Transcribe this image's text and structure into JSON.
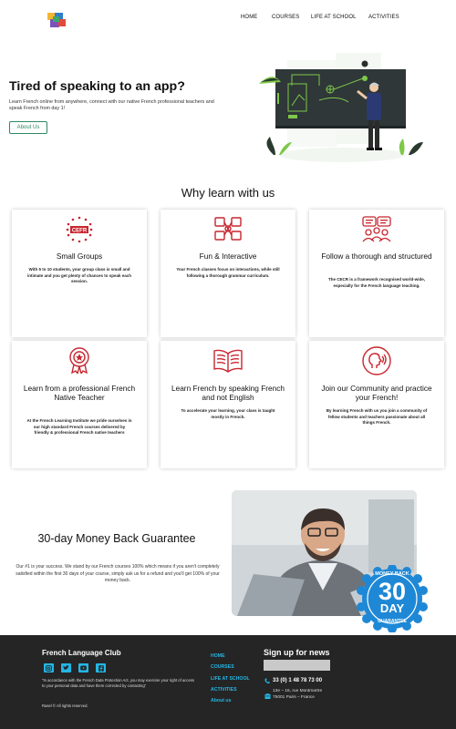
{
  "nav": {
    "items": [
      "HOME",
      "COURSES",
      "LIFE AT SCHOOL",
      "ACTIVITIES"
    ]
  },
  "hero": {
    "title": "Tired of speaking to an app?",
    "text": "Learn French online from anywhere, connect with our native French professional teachers and speak French from day 1!",
    "button": "About Us"
  },
  "why": {
    "title": "Why learn with us",
    "cards": [
      {
        "title": "Small Groups",
        "text": "With 5 to 10 students, your group class is small and intimate and you get plenty of chances to speak each session.",
        "icon": "cefr-stars-icon",
        "badge": "CEFR"
      },
      {
        "title": "Fun & Interactive",
        "text": "Your French classes focus on interactions, while still following a thorough grammar curriculum.",
        "icon": "hands-together-icon"
      },
      {
        "title": "Follow a thorough and structured",
        "text": "The CECR is a framework recognised world-wide, especially for the French language teaching.",
        "icon": "group-chat-icon"
      },
      {
        "title": "Learn from a professional French Native Teacher",
        "text": "At the French Learning Institute we pride ourselves in our high standard French courses delivered by friendly & professional French native teachers",
        "icon": "award-medal-icon"
      },
      {
        "title": "Learn French by speaking French and not English",
        "text": "To accelerate your learning, your class is taught mostly in French.",
        "icon": "open-book-icon"
      },
      {
        "title": "Join our Community and practice your French!",
        "text": "By learning French with us you join a community of fellow students and teachers passionate about all things French.",
        "icon": "speaking-head-icon"
      }
    ]
  },
  "guarantee": {
    "title": "30-day Money Back Guarantee",
    "text": "Our #1 is your success. We stand by our French courses 100% which means if you aren't completely satisfied within the first 30 days of your course, simply ask us for a refund and you'll get 100% of your money back.",
    "badge_top": "MONEY BACK",
    "badge_number": "30",
    "badge_day": "DAY",
    "badge_bottom": "GUARANTEE"
  },
  "footer": {
    "brand": "French Language Club",
    "social_icons": [
      "instagram-icon",
      "twitter-icon",
      "youtube-icon",
      "facebook-icon"
    ],
    "note": "\"In accordance with the French Data Protection Act, you may exercise your right of access to your personal data and have them corrected by contacting\"",
    "copyright": "Rasel © All rights reserved.",
    "links": [
      "HOME",
      "COURSES",
      "LIFE AT SCHOOL",
      "ACTIVITIES",
      "About us"
    ],
    "signup_title": "Sign up for news",
    "signup_placeholder": "",
    "phone": "33 (0) 1 48 78 73 00",
    "address_line1": "13e – 15, rue Montmartre",
    "address_line2": "75001 Paris – France"
  },
  "colors": {
    "accent_green": "#2c8a64",
    "accent_red": "#c8262f",
    "link_blue": "#24b6e5",
    "footer_bg": "#252525",
    "badge_blue": "#1e88d6"
  }
}
